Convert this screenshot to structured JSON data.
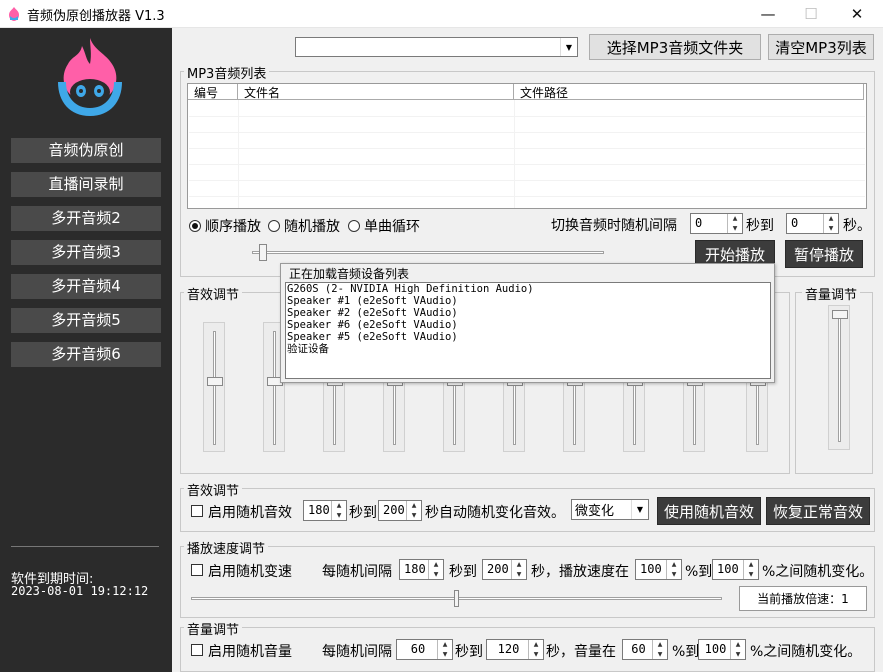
{
  "window": {
    "title": "音频伪原创播放器 V1.3",
    "minimize": "—",
    "maximize": "☐",
    "close": "✕"
  },
  "colors": {
    "accent_pink": "#ff5fa8",
    "accent_blue": "#3fa8e8",
    "sidebar": "#2b2b2b"
  },
  "sidebar": {
    "items": [
      {
        "label": "音频伪原创"
      },
      {
        "label": "直播间录制"
      },
      {
        "label": "多开音频2"
      },
      {
        "label": "多开音频3"
      },
      {
        "label": "多开音频4"
      },
      {
        "label": "多开音频5"
      },
      {
        "label": "多开音频6"
      }
    ],
    "expire_label": "软件到期时间:",
    "expire_time": "2023-08-01 19:12:12"
  },
  "top": {
    "device_select_value": "",
    "choose_mp3_folder": "选择MP3音频文件夹",
    "clear_mp3_list": "清空MP3列表"
  },
  "mp3_list": {
    "group_label": "MP3音频列表",
    "columns": [
      "编号",
      "文件名",
      "文件路径"
    ],
    "rows": []
  },
  "playback": {
    "modes": [
      {
        "label": "顺序播放",
        "selected": true
      },
      {
        "label": "随机播放",
        "selected": false
      },
      {
        "label": "单曲循环",
        "selected": false
      }
    ],
    "interval_label": "切换音频时随机间隔",
    "interval_from": "0",
    "interval_mid": "秒到",
    "interval_to": "0",
    "interval_unit": "秒。",
    "progress": 0.02,
    "start_button": "开始播放",
    "pause_button": "暂停播放"
  },
  "eq": {
    "group_label": "音效调节",
    "band_levels": [
      0.55,
      0.55,
      0.55,
      0.55,
      0.55,
      0.55,
      0.55,
      0.55,
      0.55,
      0.55
    ]
  },
  "volume_panel": {
    "group_label": "音量调节",
    "level": 0.97
  },
  "device_popup": {
    "title": "正在加载音频设备列表",
    "devices": [
      "G260S (2- NVIDIA High Definition Audio)",
      "Speaker #1 (e2eSoft VAudio)",
      "Speaker #2 (e2eSoft VAudio)",
      "Speaker #6 (e2eSoft VAudio)",
      "Speaker #5 (e2eSoft VAudio)",
      "验证设备"
    ]
  },
  "effect": {
    "group_label": "音效调节",
    "enable_label": "启用随机音效",
    "from": "180",
    "mid": "秒到",
    "to": "200",
    "suffix": "秒自动随机变化音效。",
    "preset_value": "微变化",
    "use_random_button": "使用随机音效",
    "restore_button": "恢复正常音效"
  },
  "speed": {
    "group_label": "播放速度调节",
    "enable_label": "启用随机变速",
    "interval_label": "每随机间隔",
    "from": "180",
    "mid": "秒到",
    "to": "200",
    "rate_label": "秒，播放速度在",
    "rate_from": "100",
    "rate_mid": "%到",
    "rate_to": "100",
    "rate_suffix": "%之间随机变化。",
    "slider_level": 0.5,
    "current_rate": "当前播放倍速：1"
  },
  "volume": {
    "group_label": "音量调节",
    "enable_label": "启用随机音量",
    "interval_label": "每随机间隔",
    "from": "60",
    "mid": "秒到",
    "to": "120",
    "vol_label": "秒，音量在",
    "vol_from": "60",
    "vol_mid": "%到",
    "vol_to": "100",
    "vol_suffix": "%之间随机变化。"
  }
}
